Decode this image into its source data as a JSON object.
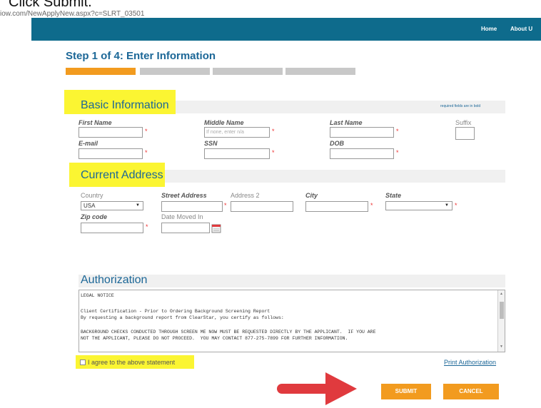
{
  "caption": "Click Submit.",
  "browser": {
    "url": "iow.com/NewApplyNew.aspx?c=SLRT_03501"
  },
  "nav": {
    "home": "Home",
    "about": "About U"
  },
  "step": {
    "title": "Step 1 of 4: Enter Information",
    "total": 4,
    "current": 1,
    "active_color": "#f29b1f"
  },
  "basic": {
    "title": "Basic Information",
    "required_note": "required fields are in bold",
    "first_name_label": "First Name",
    "middle_name_label": "Middle Name",
    "middle_name_placeholder": "If none, enter n/a",
    "last_name_label": "Last Name",
    "suffix_label": "Suffix",
    "email_label": "E-mail",
    "ssn_label": "SSN",
    "dob_label": "DOB"
  },
  "address": {
    "title": "Current Address",
    "country_label": "Country",
    "country_value": "USA",
    "street_label": "Street Address",
    "address2_label": "Address 2",
    "city_label": "City",
    "state_label": "State",
    "zip_label": "Zip code",
    "date_moved_label": "Date Moved In"
  },
  "authorization": {
    "title": "Authorization",
    "legal_lines": [
      "LEGAL NOTICE",
      "Client Certification - Prior to Ordering Background Screening Report",
      "By requesting a background report from ClearStar, you certify as follows:",
      "BACKGROUND CHECKS CONDUCTED THROUGH SCREEN ME NOW MUST BE REQUESTED DIRECTLY BY THE APPLICANT.  IF YOU ARE",
      "NOT THE APPLICANT, PLEASE DO NOT PROCEED.  YOU MAY CONTACT 877-275-7899 FOR FURTHER INFORMATION."
    ],
    "agree_label": "I agree to the above statement",
    "print_link": "Print Authorization"
  },
  "buttons": {
    "submit": "SUBMIT",
    "cancel": "CANCEL"
  },
  "colors": {
    "navbar": "#0e6b8c",
    "accent": "#f29b1f",
    "highlight": "#fbf532",
    "arrow": "#e03a3e",
    "title": "#1c6797"
  }
}
